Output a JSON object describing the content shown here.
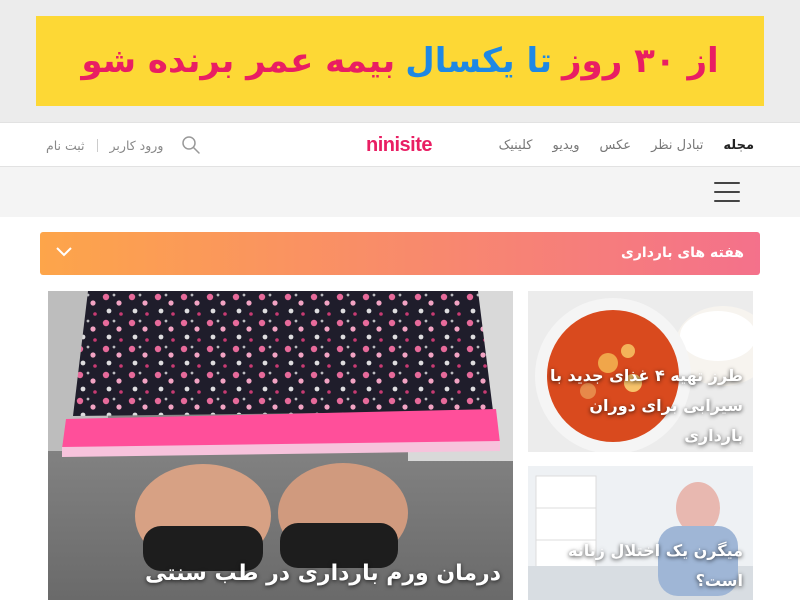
{
  "ad": {
    "part1": "از ۳۰ روز",
    "part2": "تا یکسال",
    "part3": "بیمه عمر برنده شو",
    "colors": {
      "background": "#fdd835",
      "pink": "#e91e63",
      "blue": "#1e88e5"
    }
  },
  "header": {
    "nav": [
      "مجله",
      "تبادل نظر",
      "عکس",
      "ویدیو",
      "کلینیک"
    ],
    "logo": "ninisite",
    "login": "ورود کاربر",
    "signup": "ثبت نام",
    "icons": {
      "search": "search-icon"
    }
  },
  "menu": {
    "icon": "hamburger-menu-icon"
  },
  "accordion": {
    "label": "هفته های بارداری",
    "icon": "chevron-down-icon",
    "gradient": [
      "#fda54a",
      "#f4718b"
    ]
  },
  "articles": {
    "main": {
      "title": "درمان ورم بارداری در طب سنتی"
    },
    "side1": {
      "title": "طرز تهیه ۴ غذای جدید با سیرابی برای دوران بارداری"
    },
    "side2": {
      "title": "میگرن یک اختلال زنانه است؟"
    }
  },
  "colors": {
    "brand": "#e91e63"
  }
}
